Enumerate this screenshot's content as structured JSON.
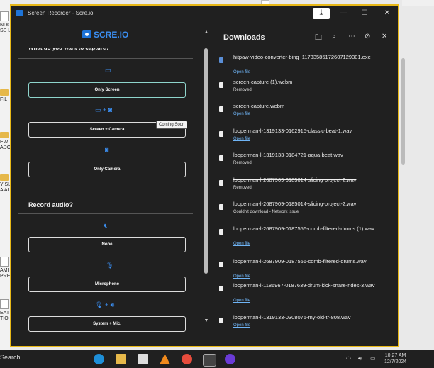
{
  "desktop": {
    "items": [
      {
        "text": "NDO\nSS LI",
        "kind": "doc"
      },
      {
        "text": "FIL",
        "kind": "folder"
      },
      {
        "text": "EW\nADO",
        "kind": "folder"
      },
      {
        "text": "Y SLI\nA AI",
        "kind": "folder"
      },
      {
        "text": "AMI\nPRE",
        "kind": "doc"
      },
      {
        "text": "EAT\nTIO",
        "kind": "doc"
      }
    ]
  },
  "window": {
    "title": "Screen Recorder - Scre.io",
    "icons": [
      "download-status-icon",
      "minimize-icon",
      "maximize-icon",
      "close-icon"
    ]
  },
  "recorder": {
    "logo": "SCRE.IO",
    "capture_heading": "What do you want to capture?",
    "capture_options": [
      {
        "label": "Only Screen",
        "icon": "monitor-icon",
        "selected": true
      },
      {
        "label": "Screen + Camera",
        "icon": "monitor-camera-icon",
        "selected": false
      },
      {
        "label": "Only Camera",
        "icon": "camera-icon",
        "selected": false
      }
    ],
    "tooltip": "Coming Soon",
    "audio_heading": "Record audio?",
    "audio_options": [
      {
        "label": "None",
        "icon": "mute-icon"
      },
      {
        "label": "Microphone",
        "icon": "microphone-icon"
      },
      {
        "label": "System + Mic.",
        "icon": "mic-speaker-icon"
      }
    ]
  },
  "downloads": {
    "title": "Downloads",
    "items": [
      {
        "name": "hitpaw-video-converter-bing_11733585172607129301.exe",
        "status": "Open file",
        "removed": false,
        "type": "exe"
      },
      {
        "name": "screen-capture (1).webm",
        "status": "Removed",
        "removed": true,
        "type": "file"
      },
      {
        "name": "screen-capture.webm",
        "status": "Open file",
        "removed": false,
        "type": "file"
      },
      {
        "name": "looperman-l-1319133-0162915-classic-beat-1.wav",
        "status": "Open file",
        "removed": false,
        "type": "file"
      },
      {
        "name": "looperman-l-1319133-0184721-aqua-beat.wav",
        "status": "Removed",
        "removed": true,
        "type": "file"
      },
      {
        "name": "looperman-l-2687909-0185014-slicing-project-2.wav",
        "status": "Removed",
        "removed": true,
        "type": "file"
      },
      {
        "name": "looperman-l-2687909-0185014-slicing-project-2.wav",
        "status": "Couldn't download - Network issue",
        "removed": false,
        "type": "file"
      },
      {
        "name": "looperman-l-2687909-0187556-comb-filtered-drums (1).wav",
        "status": "Open file",
        "removed": false,
        "type": "file"
      },
      {
        "name": "looperman-l-2687909-0187556-comb-filtered-drums.wav",
        "status": "Open file",
        "removed": false,
        "type": "file"
      },
      {
        "name": "looperman-l-1186967-0187639-drum-kick-snare-rides-3.wav",
        "status": "Open file",
        "removed": false,
        "type": "file"
      },
      {
        "name": "looperman-l-1319133-0308075-my-old-tr-808.wav",
        "status": "Open file",
        "removed": false,
        "type": "file"
      }
    ]
  },
  "taskbar": {
    "search": "Search",
    "time": "10:27 AM",
    "date": "12/7/2024"
  },
  "colors": {
    "accent": "#3b8ef0",
    "window_border": "#e8b818",
    "selected_border": "#8fd5cc",
    "link": "#6fb4f5"
  }
}
